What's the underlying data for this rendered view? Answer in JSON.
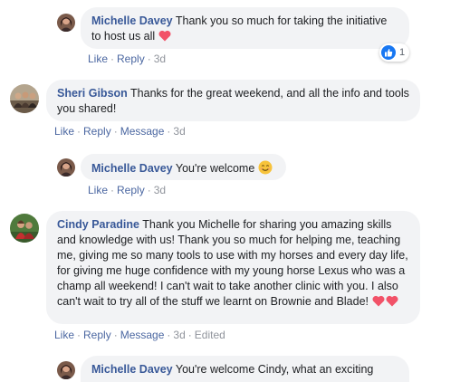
{
  "actions": {
    "like": "Like",
    "reply": "Reply",
    "message": "Message",
    "separator": "·"
  },
  "comments": [
    {
      "author": "Michelle Davey",
      "text": "Thank you so much for taking the initiative to host us all",
      "emoji": "heart-icon",
      "time": "3d",
      "reactions": {
        "count": "1",
        "type": "like-icon"
      }
    },
    {
      "author": "Sheri Gibson",
      "text": "Thanks for the great weekend, and all the info and tools you shared!",
      "time": "3d"
    },
    {
      "author": "Michelle Davey",
      "text": "You're welcome",
      "emoji": "smile-icon",
      "time": "3d"
    },
    {
      "author": "Cindy Paradine",
      "text": "Thank you Michelle for sharing you amazing skills and knowledge with us! Thank you so much for helping me, teaching me, giving me so many tools to use with my horses and every day life, for giving me huge confidence with my young horse Lexus who was a champ all weekend! I can't wait to take another clinic with you. I also can't wait to try all of the stuff we learnt on Brownie and Blade!",
      "emoji": "two-hearts-icon",
      "time": "3d",
      "edited": "Edited"
    },
    {
      "author": "Michelle Davey",
      "text": "You're welcome Cindy, what an exciting"
    }
  ],
  "colors": {
    "name": "#385898",
    "link": "#4b67a1",
    "bubble": "#f2f3f5",
    "heart": "#f25268",
    "like": "#1877f2"
  }
}
